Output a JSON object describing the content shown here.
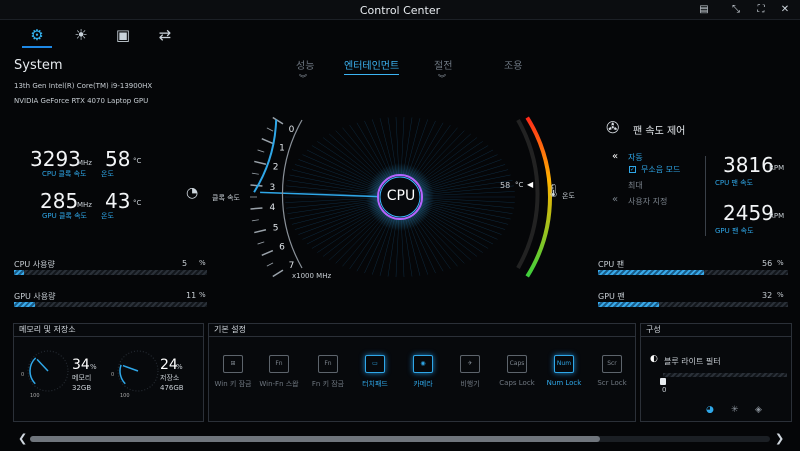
{
  "window": {
    "title": "Control Center"
  },
  "nav": {
    "icons": [
      "settings-icon",
      "display-brightness-icon",
      "fn-key-icon",
      "usb-device-icon"
    ]
  },
  "modes": [
    "성능",
    "엔터테인먼트",
    "절전",
    "조용"
  ],
  "system": {
    "title": "System",
    "cpu_name": "13th Gen Intel(R) Core(TM) i9-13900HX",
    "gpu_name": "NVIDIA GeForce RTX 4070 Laptop GPU",
    "cpu_clock": "3293",
    "cpu_clock_unit": "MHz",
    "cpu_clock_label": "CPU 클록 속도",
    "cpu_temp": "58",
    "temp_unit": "°C",
    "temp_label": "온도",
    "gpu_clock": "285",
    "gpu_clock_unit": "MHz",
    "gpu_clock_label": "GPU 클록 속도",
    "gpu_temp": "43",
    "cpu_usage_label": "CPU 사용량",
    "cpu_usage": "5",
    "cpu_usage_pct": 5,
    "gpu_usage_label": "GPU 사용량",
    "gpu_usage": "11",
    "gpu_usage_pct": 11,
    "percent": "%"
  },
  "gauge": {
    "center_label": "CPU",
    "ticks": [
      "7",
      "6",
      "5",
      "4",
      "3",
      "2",
      "1",
      "0"
    ],
    "unit": "x1000 MHz",
    "clock_label": "클록 속도",
    "temp_value": "58",
    "temp_unit": "°C",
    "temp_label": "온도",
    "clock_value": 3.293,
    "temp_fraction": 0.58
  },
  "fan": {
    "title": "팬 속도 제어",
    "auto": "자동",
    "silent_mode": "무소음 모드",
    "max": "최대",
    "custom": "사용자 지정",
    "cpu_fan_rpm": "3816",
    "rpm_unit": "RPM",
    "cpu_fan_label": "CPU 팬 속도",
    "gpu_fan_rpm": "2459",
    "gpu_fan_label": "GPU 팬 속도",
    "cpu_fan_bar_label": "CPU 팬",
    "cpu_fan_pct": "56",
    "cpu_fan_fill": 56,
    "gpu_fan_bar_label": "GPU 팬",
    "gpu_fan_pct": "32",
    "gpu_fan_fill": 32
  },
  "memory": {
    "title": "메모리 및 저장소",
    "mem_pct": "34",
    "mem_label": "메모리",
    "mem_size": "32GB",
    "mem_fill": 34,
    "sto_pct": "24",
    "sto_label": "저장소",
    "sto_size": "476GB",
    "sto_fill": 24,
    "scale_min": "0",
    "scale_max": "100",
    "percent": "%"
  },
  "basic": {
    "title": "기본 설정",
    "tiles": [
      {
        "label": "Win 키 잠금",
        "glyph": "⊞",
        "on": false
      },
      {
        "label": "Win-Fn 스왑",
        "glyph": "Fn",
        "on": false
      },
      {
        "label": "Fn 키 잠금",
        "glyph": "Fn",
        "on": false
      },
      {
        "label": "터치패드",
        "glyph": "▭",
        "on": true
      },
      {
        "label": "카메라",
        "glyph": "◉",
        "on": true
      },
      {
        "label": "비행기",
        "glyph": "✈",
        "on": false
      },
      {
        "label": "Caps Lock",
        "glyph": "Caps",
        "on": false
      },
      {
        "label": "Num Lock",
        "glyph": "Num",
        "on": true
      },
      {
        "label": "Scr Lock",
        "glyph": "Scr",
        "on": false
      }
    ]
  },
  "config": {
    "title": "구성",
    "blue_light": "블루 라이트 필터",
    "slider_value": "0",
    "slider_fill": 0
  },
  "colors": {
    "accent": "#2fa7e8",
    "background": "#050608"
  }
}
